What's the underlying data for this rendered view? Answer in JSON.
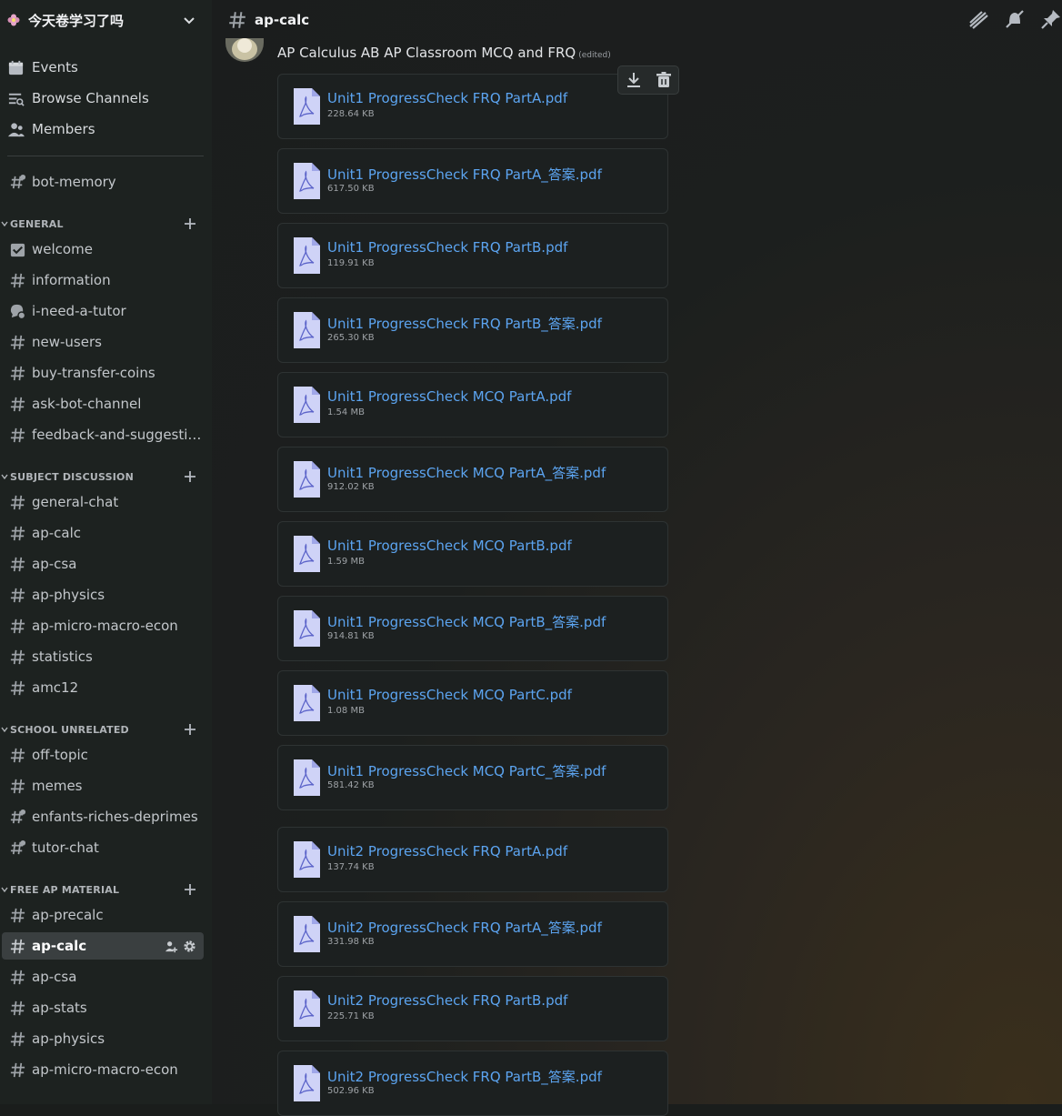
{
  "server": {
    "name": "今天卷学习了吗"
  },
  "nav": [
    {
      "label": "Events",
      "icon": "calendar-icon"
    },
    {
      "label": "Browse Channels",
      "icon": "browse-channels-icon"
    },
    {
      "label": "Members",
      "icon": "members-icon"
    }
  ],
  "pinned_channel": {
    "label": "bot-memory"
  },
  "categories": [
    {
      "name": "GENERAL",
      "channels": [
        "welcome",
        "information",
        "i-need-a-tutor",
        "new-users",
        "buy-transfer-coins",
        "ask-bot-channel",
        "feedback-and-suggestio..."
      ]
    },
    {
      "name": "SUBJECT DISCUSSION",
      "channels": [
        "general-chat",
        "ap-calc",
        "ap-csa",
        "ap-physics",
        "ap-micro-macro-econ",
        "statistics",
        "amc12"
      ]
    },
    {
      "name": "SCHOOL UNRELATED",
      "channels": [
        "off-topic",
        "memes",
        "enfants-riches-deprimes",
        "tutor-chat"
      ]
    },
    {
      "name": "FREE AP MATERIAL",
      "channels": [
        "ap-precalc",
        "ap-calc",
        "ap-csa",
        "ap-stats",
        "ap-physics",
        "ap-micro-macro-econ"
      ]
    }
  ],
  "active_channel": "ap-calc",
  "header": {
    "channel": "ap-calc"
  },
  "message": {
    "text": "AP Calculus AB AP Classroom MCQ and FRQ",
    "edited": "(edited)"
  },
  "files": [
    {
      "name": "Unit1 ProgressCheck FRQ PartA.pdf",
      "size": "228.64 KB"
    },
    {
      "name": "Unit1 ProgressCheck FRQ PartA_答案.pdf",
      "size": "617.50 KB"
    },
    {
      "name": "Unit1 ProgressCheck FRQ PartB.pdf",
      "size": "119.91 KB"
    },
    {
      "name": "Unit1 ProgressCheck FRQ PartB_答案.pdf",
      "size": "265.30 KB"
    },
    {
      "name": "Unit1 ProgressCheck MCQ PartA.pdf",
      "size": "1.54 MB"
    },
    {
      "name": "Unit1 ProgressCheck MCQ PartA_答案.pdf",
      "size": "912.02 KB"
    },
    {
      "name": "Unit1 ProgressCheck MCQ PartB.pdf",
      "size": "1.59 MB"
    },
    {
      "name": "Unit1 ProgressCheck MCQ PartB_答案.pdf",
      "size": "914.81 KB"
    },
    {
      "name": "Unit1 ProgressCheck MCQ PartC.pdf",
      "size": "1.08 MB"
    },
    {
      "name": "Unit1 ProgressCheck MCQ PartC_答案.pdf",
      "size": "581.42 KB"
    },
    {
      "name": "Unit2 ProgressCheck FRQ PartA.pdf",
      "size": "137.74 KB"
    },
    {
      "name": "Unit2 ProgressCheck FRQ PartA_答案.pdf",
      "size": "331.98 KB"
    },
    {
      "name": "Unit2 ProgressCheck FRQ PartB.pdf",
      "size": "225.71 KB"
    },
    {
      "name": "Unit2 ProgressCheck FRQ PartB_答案.pdf",
      "size": "502.96 KB"
    }
  ],
  "colors": {
    "link": "#5ca4f0",
    "sidebar": "#1d2220",
    "active_channel_bg": "#3a3f40"
  }
}
